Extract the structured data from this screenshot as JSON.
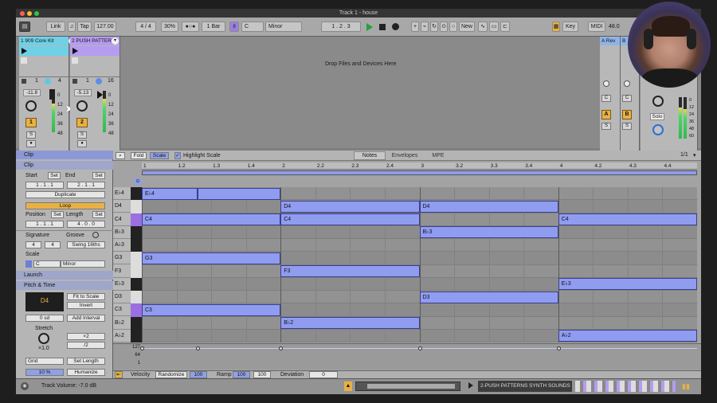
{
  "window": {
    "title": "Track 1 - house"
  },
  "control_bar": {
    "link": "Link",
    "tap": "Tap",
    "tempo": "127.00",
    "signature": "4 / 4",
    "swing": "30%",
    "quantize": "1 Bar",
    "scale_root": "C",
    "scale_mode": "Minor",
    "position": "1 .  2 .  3",
    "new_label": "New",
    "key_label": "Key",
    "midi_label": "MIDI",
    "cpu": "48.0"
  },
  "session": {
    "drop_text": "Drop Files and Devices Here"
  },
  "tracks": [
    {
      "name": "1 909 Core Kit",
      "volume": "-11.8",
      "number": "1",
      "sends": [
        "1",
        "4"
      ],
      "db_ticks": [
        "0",
        "12",
        "24",
        "36",
        "48",
        "60"
      ]
    },
    {
      "name": "2 PUSH PATTER",
      "volume": "-5.13",
      "number": "2",
      "sends": [
        "1",
        "16"
      ],
      "db_ticks": [
        "0",
        "12",
        "24",
        "36",
        "48",
        "60"
      ]
    }
  ],
  "returns": [
    {
      "name": "A Rev",
      "letter": "A"
    },
    {
      "name": "B",
      "letter": "B"
    }
  ],
  "master": {
    "solo": "Solo",
    "ticks": [
      "0",
      "12",
      "24",
      "36",
      "48",
      "60"
    ]
  },
  "clip_panel": {
    "tab": "Clip",
    "header": "Clip",
    "start_label": "Start",
    "end_label": "End",
    "set": "Set",
    "start": "1 .  1 .  1",
    "end": "2 .  1 .  1",
    "duplicate": "Duplicate",
    "loop": "Loop",
    "position_label": "Position",
    "length_label": "Length",
    "position": "1 .  1 .  1",
    "length": "4 .  0 .  0",
    "signature_label": "Signature",
    "groove_label": "Groove",
    "sig_num": "4",
    "sig_den": "4",
    "groove": "Swing 16ths",
    "scale_label": "Scale",
    "scale_root": "C",
    "scale_mode": "Minor",
    "launch": "Launch",
    "pitch_time": "Pitch & Time",
    "transpose": "D4",
    "fit_to_scale": "Fit to Scale",
    "invert": "Invert",
    "semitones": "0 sd",
    "add_interval": "Add Interval",
    "stretch_label": "Stretch",
    "stretch": "×1.0",
    "times2": "×2",
    "div2": "/2",
    "grid": "Grid",
    "set_length": "Set Length",
    "humanize_pct": "10 %",
    "humanize": "Humanize"
  },
  "editor": {
    "fold": "Fold",
    "scale": "Scale",
    "highlight_scale": "Highlight Scale",
    "tabs": [
      "Notes",
      "Envelopes",
      "MPE"
    ],
    "page": "1/1",
    "ruler": [
      "1",
      "1.2",
      "1.3",
      "1.4",
      "2",
      "2.2",
      "2.3",
      "2.4",
      "3",
      "3.2",
      "3.3",
      "3.4",
      "4",
      "4.2",
      "4.3",
      "4.4"
    ],
    "rows": [
      "E♭4",
      "D4",
      "C4",
      "B♭3",
      "A♭3",
      "G3",
      "F3",
      "E♭3",
      "D3",
      "C3",
      "B♭2",
      "A♭2"
    ],
    "notes": [
      {
        "pitch": "E♭4",
        "start": 0,
        "dur": 0.4,
        "label": "E♭4"
      },
      {
        "pitch": "E♭4",
        "start": 0.4,
        "dur": 0.6,
        "label": ""
      },
      {
        "pitch": "D4",
        "start": 1,
        "dur": 1,
        "label": "D4"
      },
      {
        "pitch": "D4",
        "start": 2,
        "dur": 1,
        "label": "D4"
      },
      {
        "pitch": "C4",
        "start": 0,
        "dur": 1,
        "label": "C4"
      },
      {
        "pitch": "C4",
        "start": 1,
        "dur": 1,
        "label": "C4"
      },
      {
        "pitch": "C4",
        "start": 3,
        "dur": 1,
        "label": "C4"
      },
      {
        "pitch": "B♭3",
        "start": 2,
        "dur": 1,
        "label": "B♭3"
      },
      {
        "pitch": "G3",
        "start": 0,
        "dur": 1,
        "label": "G3"
      },
      {
        "pitch": "F3",
        "start": 1,
        "dur": 1,
        "label": "F3"
      },
      {
        "pitch": "E♭3",
        "start": 3,
        "dur": 1,
        "label": "E♭3"
      },
      {
        "pitch": "D3",
        "start": 2,
        "dur": 1,
        "label": "D3"
      },
      {
        "pitch": "C3",
        "start": 0,
        "dur": 1,
        "label": "C3"
      },
      {
        "pitch": "B♭2",
        "start": 1,
        "dur": 1,
        "label": "B♭2"
      },
      {
        "pitch": "A♭2",
        "start": 3,
        "dur": 1,
        "label": "A♭2"
      }
    ],
    "velocity_ticks": [
      "127",
      "64",
      "1"
    ],
    "velocity_label": "Velocity",
    "randomize": "Randomize",
    "velocity_value": "100",
    "ramp_label": "Ramp",
    "ramp_a": "100",
    "ramp_b": "100",
    "deviation_label": "Deviation",
    "deviation": "0"
  },
  "status": {
    "message": "Track Volume: -7.0 dB",
    "device": "2-PUSH PATTERNS SYNTH SOUNDS"
  }
}
